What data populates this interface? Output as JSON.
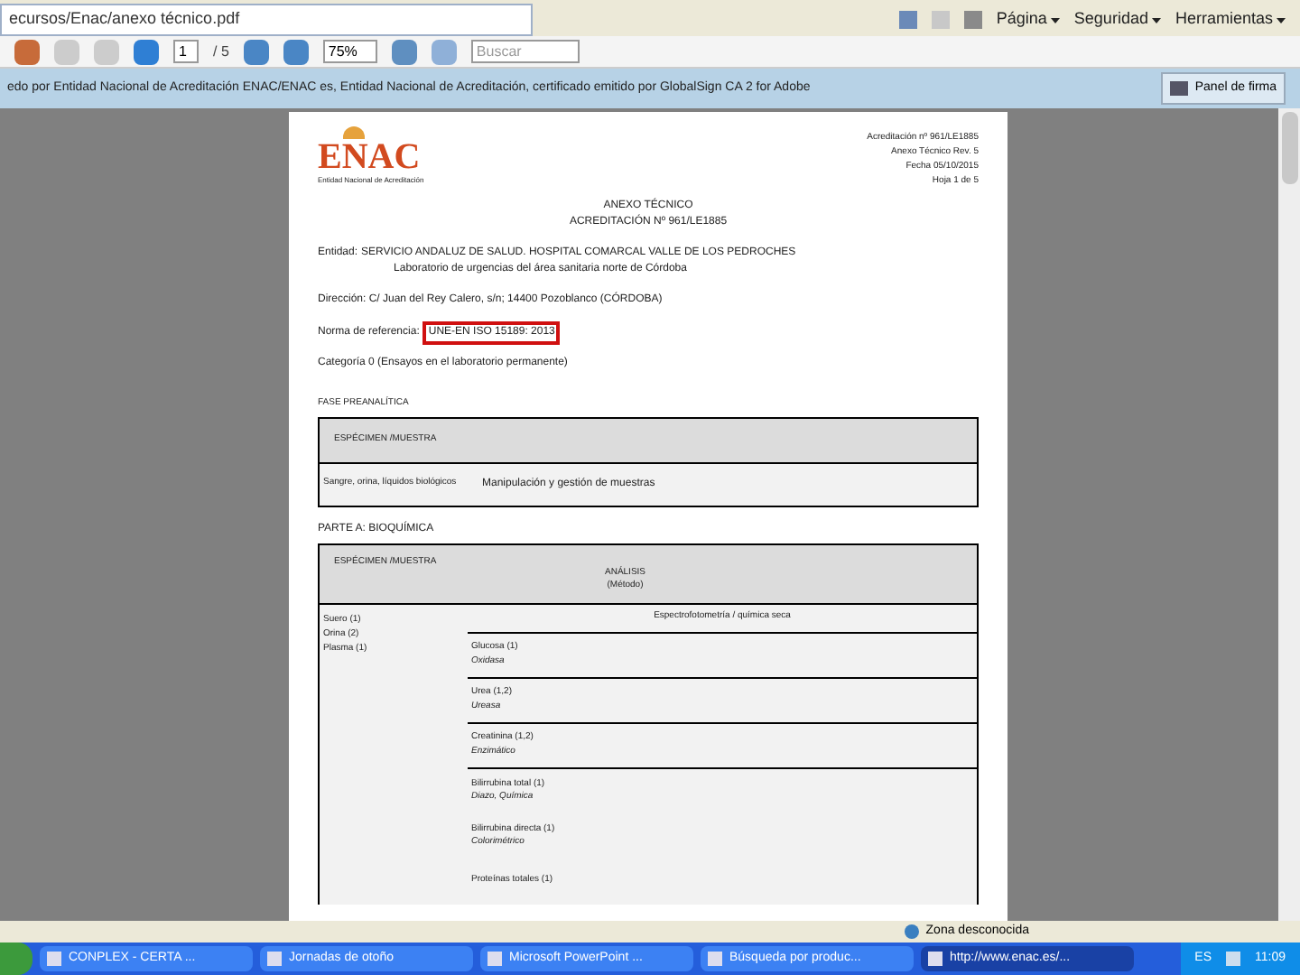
{
  "browser_tab": {
    "title": "ecursos/Enac/anexo técnico.pdf"
  },
  "command_bar": [
    "Página",
    "Seguridad",
    "Herramientas"
  ],
  "toolbar": {
    "page": "1",
    "page_count": "/ 5",
    "zoom": "75%",
    "search_placeholder": "Buscar"
  },
  "signature_bar": {
    "text": "edo por Entidad Nacional de Acreditación ENAC/ENAC es, Entidad Nacional de Acreditación, certificado emitido por GlobalSign CA 2 for Adobe",
    "button": "Panel de firma"
  },
  "document": {
    "logo": {
      "name": "ENAC",
      "subtitle": "Entidad Nacional de Acreditación"
    },
    "header_info": [
      "Acreditación nº 961/LE1885",
      "Anexo Técnico Rev. 5",
      "Fecha 05/10/2015",
      "Hoja 1 de 5"
    ],
    "title": [
      "ANEXO TÉCNICO",
      "ACREDITACIÓN Nº 961/LE1885"
    ],
    "entity_label": "Entidad:",
    "entity": [
      "SERVICIO ANDALUZ DE SALUD. HOSPITAL COMARCAL VALLE DE LOS PEDROCHES",
      "Laboratorio de urgencias del área sanitaria norte de Córdoba"
    ],
    "address": "Dirección: C/ Juan del Rey Calero, s/n; 14400 Pozoblanco (CÓRDOBA)",
    "norm_label": "Norma de referencia:",
    "norm": "UNE-EN ISO 15189: 2013",
    "category": "Categoría 0 (Ensayos en el laboratorio permanente)",
    "preanalytic": {
      "heading": "FASE PREANALÍTICA",
      "column": "ESPÉCIMEN /MUESTRA",
      "specimen": "Sangre, orina, líquidos biológicos",
      "analysis": "Manipulación y gestión de muestras"
    },
    "part_a": {
      "heading": "PARTE A: BIOQUÍMICA",
      "columns": [
        "ESPÉCIMEN /MUESTRA",
        "ANÁLISIS",
        "(Método)"
      ],
      "specimens": [
        "Suero (1)",
        "Orina (2)",
        "Plasma (1)"
      ],
      "method_group": "Espectrofotometría / química seca",
      "analyses": [
        {
          "name": "Glucosa (1)",
          "method": "Oxidasa"
        },
        {
          "name": "Urea (1,2)",
          "method": "Ureasa"
        },
        {
          "name": "Creatinina (1,2)",
          "method": "Enzimático"
        },
        {
          "name": "Bilirrubina total (1)",
          "method": "Diazo, Química"
        },
        {
          "name": "Bilirrubina directa (1)",
          "method": "Colorimétrico"
        },
        {
          "name": "Proteínas totales (1)"
        }
      ]
    }
  },
  "status_bar": {
    "zone": "Zona desconocida"
  },
  "taskbar": {
    "items": [
      {
        "label": "CONPLEX - CERTA ...",
        "selected": false
      },
      {
        "label": "Jornadas de otoño",
        "selected": false
      },
      {
        "label": "Microsoft PowerPoint ...",
        "selected": false
      },
      {
        "label": "Búsqueda por produc...",
        "selected": false
      },
      {
        "label": "http://www.enac.es/...",
        "selected": true
      }
    ],
    "language": "ES",
    "time": "11:09"
  }
}
